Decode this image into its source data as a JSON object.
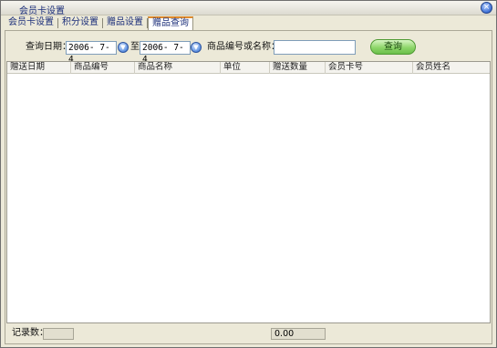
{
  "window": {
    "title": "会员卡设置",
    "close_glyph": "×"
  },
  "tabs": [
    {
      "label": "会员卡设置"
    },
    {
      "label": "积分设置"
    },
    {
      "label": "赠品设置"
    },
    {
      "label": "赠品查询"
    }
  ],
  "filters": {
    "date_label": "查询日期：",
    "date_from": "2006- 7- 4",
    "to_label": "至",
    "date_to": "2006- 7- 4",
    "product_label": "商品编号或名称：",
    "product_value": "",
    "query_button": "查询"
  },
  "table": {
    "columns": [
      "赠送日期",
      "商品编号",
      "商品名称",
      "单位",
      "赠送数量",
      "会员卡号",
      "会员姓名"
    ],
    "rows": []
  },
  "status": {
    "record_count_label": "记录数：",
    "record_count": "",
    "total": "0.00"
  },
  "colors": {
    "accent_tab": "#e08a2a",
    "query_button": "#8ed66a"
  },
  "icons": {
    "close": "close-icon",
    "calendar": "calendar-icon"
  }
}
